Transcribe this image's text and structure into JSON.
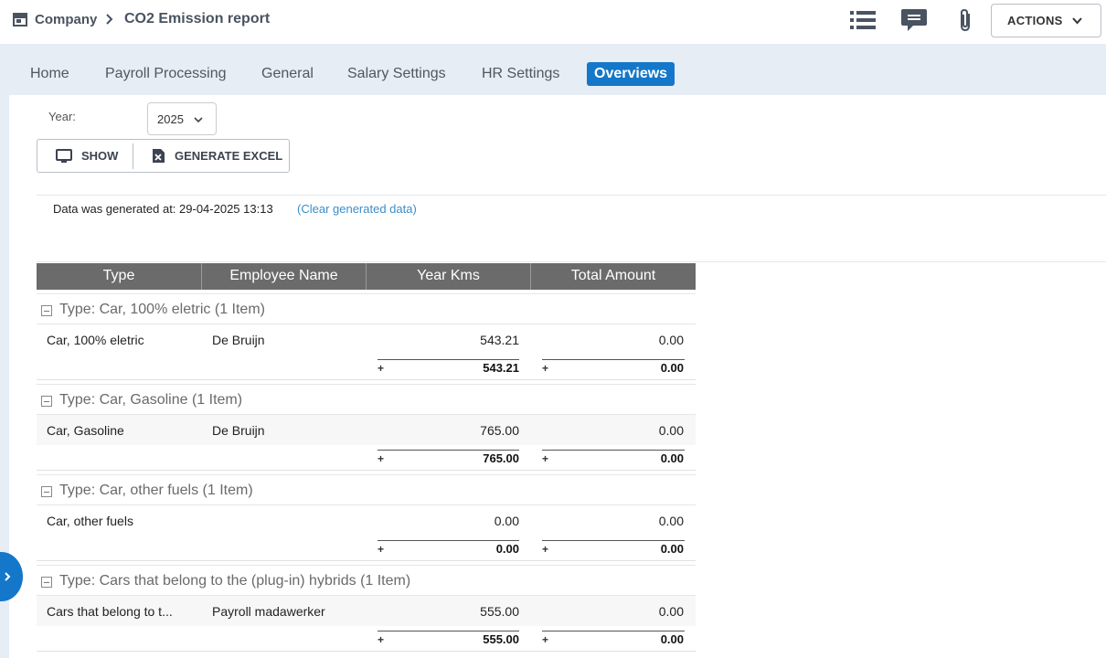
{
  "breadcrumb": {
    "company": "Company",
    "title": "CO2 Emission report"
  },
  "toolbar": {
    "actions_label": "ACTIONS"
  },
  "tabs": [
    {
      "label": "Home",
      "active": false
    },
    {
      "label": "Payroll Processing",
      "active": false
    },
    {
      "label": "General",
      "active": false
    },
    {
      "label": "Salary Settings",
      "active": false
    },
    {
      "label": "HR Settings",
      "active": false
    },
    {
      "label": "Overviews",
      "active": true
    }
  ],
  "filter": {
    "year_label": "Year:",
    "year_value": "2025"
  },
  "buttons": {
    "show_label": "SHOW",
    "excel_label": "GENERATE EXCEL"
  },
  "generated": {
    "text": "Data was generated at: 29-04-2025 13:13",
    "clear_link": "(Clear generated data)"
  },
  "grid": {
    "columns": [
      "Type",
      "Employee Name",
      "Year Kms",
      "Total Amount"
    ],
    "groups": [
      {
        "title": "Type: Car, 100% eletric (1 Item)",
        "row": {
          "type": "Car, 100% eletric",
          "employee": "De Bruijn",
          "kms": "543.21",
          "amount": "0.00"
        },
        "sum_kms": "543.21",
        "sum_amount": "0.00"
      },
      {
        "title": "Type: Car, Gasoline (1 Item)",
        "row": {
          "type": "Car, Gasoline",
          "employee": "De Bruijn",
          "kms": "765.00",
          "amount": "0.00"
        },
        "sum_kms": "765.00",
        "sum_amount": "0.00"
      },
      {
        "title": "Type: Car, other fuels (1 Item)",
        "row": {
          "type": "Car, other fuels",
          "employee": "",
          "kms": "0.00",
          "amount": "0.00"
        },
        "sum_kms": "0.00",
        "sum_amount": "0.00"
      },
      {
        "title": "Type: Cars that belong to the (plug-in) hybrids (1 Item)",
        "row": {
          "type": "Cars that belong to t...",
          "employee": "Payroll madawerker",
          "kms": "555.00",
          "amount": "0.00"
        },
        "sum_kms": "555.00",
        "sum_amount": "0.00"
      }
    ],
    "sum_symbol": "+"
  },
  "colors": {
    "accent": "#1477c9",
    "tabbar_bg": "#e6edf5",
    "grid_header_bg": "#6b6b6b",
    "link": "#3c8dc8"
  }
}
